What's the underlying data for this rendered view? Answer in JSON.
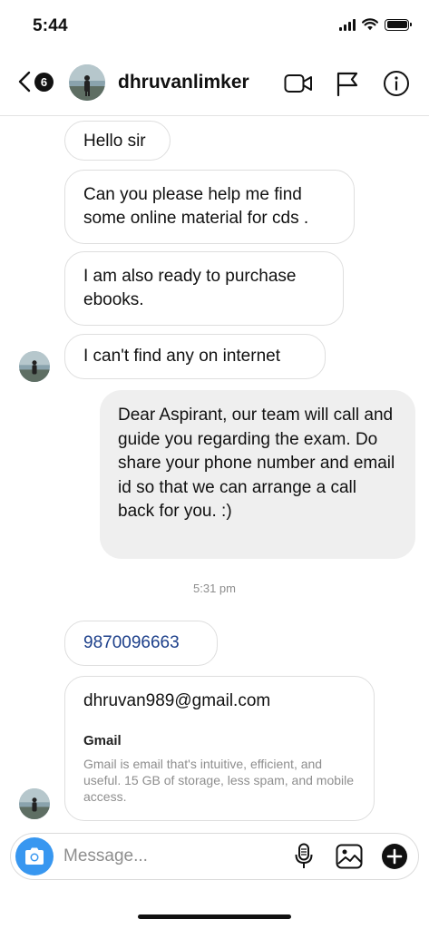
{
  "status_bar": {
    "time": "5:44"
  },
  "header": {
    "back_badge_count": "6",
    "username": "dhruvanlimker"
  },
  "messages": [
    {
      "direction": "incoming",
      "text": "Hello sir"
    },
    {
      "direction": "incoming",
      "text": "Can you please help me find some online material for cds ."
    },
    {
      "direction": "incoming",
      "text": "I am also ready to purchase ebooks."
    },
    {
      "direction": "incoming",
      "text": "I can't find any on internet"
    },
    {
      "direction": "outgoing",
      "text": "Dear Aspirant, our team will call and guide you regarding the exam. Do share your phone number and email id so that we can arrange a call back for you. :)"
    },
    {
      "direction": "timestamp",
      "text": "5:31 pm"
    },
    {
      "direction": "incoming",
      "text": "9870096663"
    },
    {
      "direction": "incoming",
      "text": "dhruvan989@gmail.com",
      "preview_title": "Gmail",
      "preview_description": "Gmail is email that's intuitive, efficient, and useful. 15 GB of storage, less spam, and mobile access."
    }
  ],
  "composer": {
    "placeholder": "Message..."
  },
  "colors": {
    "accent": "#3897f0",
    "link": "#1c3f8a",
    "outgoing_bubble": "#efefef"
  },
  "icons": [
    "back-chevron-icon",
    "video-call-icon",
    "flag-icon",
    "info-icon",
    "camera-icon",
    "microphone-icon",
    "gallery-icon",
    "plus-icon"
  ]
}
